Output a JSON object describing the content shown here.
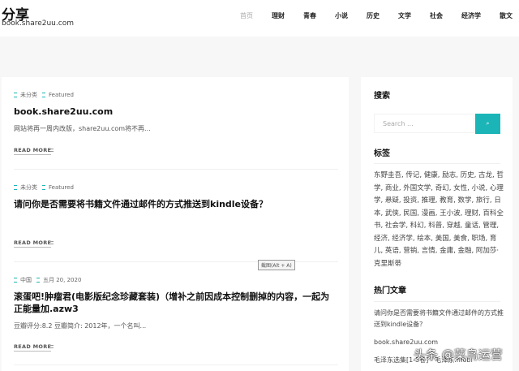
{
  "header": {
    "title": "分享",
    "tagline": "book.share2uu.com",
    "nav": [
      "首页",
      "理财",
      "青春",
      "小说",
      "历史",
      "文学",
      "社会",
      "经济学",
      "散文"
    ]
  },
  "posts": [
    {
      "category": "未分类",
      "tag": "Featured",
      "title": "book.share2uu.com",
      "excerpt": "网站将再一周内改版，share2uu.com将不再...",
      "read_more": "READ MORE"
    },
    {
      "category": "未分类",
      "tag": "Featured",
      "title": "请问你是否需要将书籍文件通过邮件的方式推送到kindle设备？",
      "excerpt": "",
      "read_more": "READ MORE"
    },
    {
      "category": "中国",
      "tag": "五月 20, 2020",
      "title": "滚蛋吧!肿瘤君(电影版纪念珍藏套装)（增补之前因成本控制删掉的内容，一起为正能量加.azw3",
      "excerpt": "豆瓣评分:8.2 豆瓣简介: 2012年，一个名叫...",
      "read_more": "READ MORE"
    }
  ],
  "tooltip": "截图(Alt + A)",
  "sidebar": {
    "search_title": "搜索",
    "search_placeholder": "Search ...",
    "search_button": "⌕",
    "tags_title": "标签",
    "tags": "东野圭吾, 传记, 健康, 励志, 历史, 古龙, 哲学, 商业, 外国文学, 奇幻, 女性, 小说, 心理学, 悬疑, 投资, 推理, 教育, 数学, 旅行, 日本, 武侠, 民国, 漫画, 王小波, 理财, 百科全书, 社会学, 科幻, 科普, 穿越, 童话, 管理, 经济, 经济学, 绘本, 美国, 美食, 职场, 育儿, 英语, 营销, 言情, 金庸, 金融, 阿加莎·克里斯蒂",
    "hot_title": "热门文章",
    "hot": [
      "请问你是否需要将书籍文件通过邮件的方式推送到kindle设备？",
      "book.share2uu.com",
      "毛泽东选集[1-5卷] - 毛泽东.mobi"
    ]
  },
  "watermark": "头条 @菜鸟运营"
}
